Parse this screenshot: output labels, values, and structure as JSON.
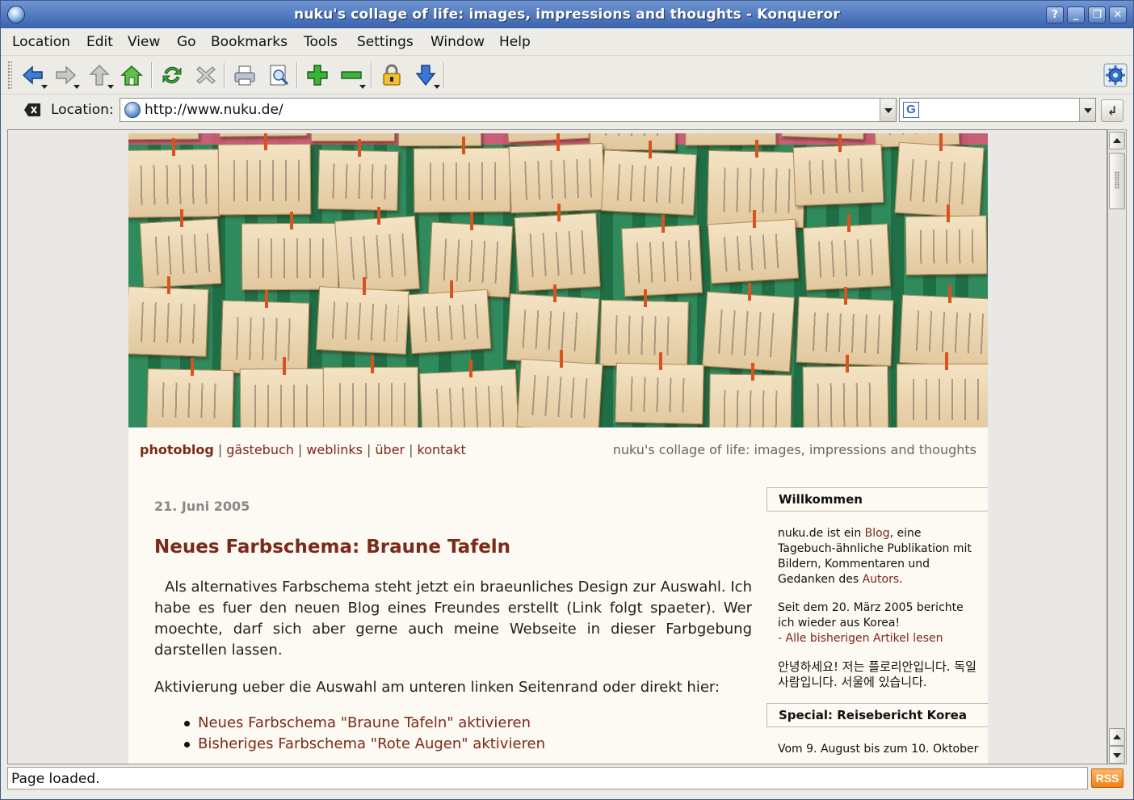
{
  "window": {
    "title": "nuku's collage of life: images, impressions and thoughts - Konqueror",
    "controls": [
      "?",
      "_",
      "❐",
      "✕"
    ]
  },
  "menu": [
    "Location",
    "Edit",
    "View",
    "Go",
    "Bookmarks",
    "Tools",
    "Settings",
    "Window",
    "Help"
  ],
  "toolbar": {
    "icons": [
      "back-icon",
      "forward-icon",
      "up-icon",
      "home-icon",
      "reload-icon",
      "stop-icon",
      "print-icon",
      "print-preview-icon",
      "zoom-in-icon",
      "zoom-out-icon",
      "security-lock-icon",
      "download-icon",
      "konqueror-gear-icon"
    ]
  },
  "location": {
    "label": "Location:",
    "url": "http://www.nuku.de/",
    "search_engine": "G",
    "search_value": "",
    "go_symbol": "↲"
  },
  "page": {
    "nav": {
      "photoblog": "photoblog",
      "gaestebuch": "gästebuch",
      "weblinks": "weblinks",
      "ueber": "über",
      "kontakt": "kontakt",
      "separator": "|"
    },
    "tagline": "nuku's collage of life: images, impressions and thoughts",
    "post": {
      "date": "21. Juni 2005",
      "title": "Neues Farbschema: Braune Tafeln",
      "paragraph1": "Als alternatives Farbschema steht jetzt ein braeunliches Design zur Auswahl. Ich habe es fuer den neuen Blog eines Freundes erstellt (Link folgt spaeter). Wer moechte, darf sich aber gerne auch meine Webseite in dieser Farbgebung darstellen lassen.",
      "paragraph2": "Aktivierung ueber die Auswahl am unteren linken Seitenrand oder direkt hier:",
      "links": [
        "Neues Farbschema \"Braune Tafeln\" aktivieren",
        "Bisheriges Farbschema \"Rote Augen\" aktivieren"
      ]
    },
    "sidebar": {
      "welcome_title": "Willkommen",
      "welcome_pre": "nuku.de ist ein ",
      "welcome_link_blog": "Blog",
      "welcome_mid": ", eine Tagebuch-ähnliche Publikation mit Bildern, Kommentaren und Gedanken des ",
      "welcome_link_autor": "Autors",
      "welcome_end": ".",
      "korea_text": "Seit dem 20. März 2005 berichte ich wieder aus Korea!",
      "articles_link": "- Alle bisherigen Artikel lesen",
      "korean_text": "안녕하세요! 저는 플로리안입니다. 독일 사람입니다. 서울에 있습니다.",
      "special_title": "Special: Reisebericht Korea",
      "special_text": "Vom 9. August bis zum 10. Oktober"
    }
  },
  "status": {
    "text": "Page loaded.",
    "rss": "RSS"
  }
}
